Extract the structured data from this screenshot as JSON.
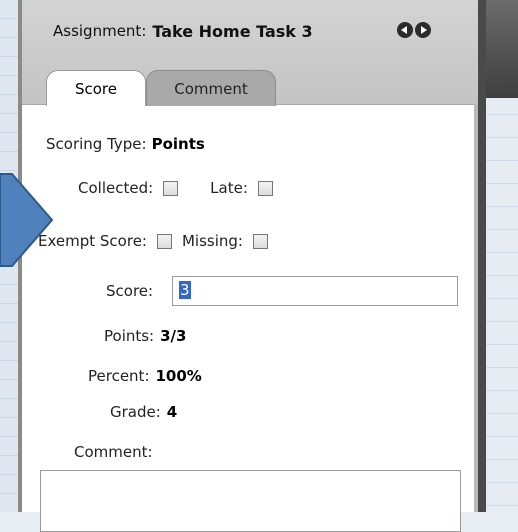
{
  "header": {
    "assignment_label": "Assignment:",
    "assignment_name": "Take Home Task 3",
    "prev_icon": "triangle-left-icon",
    "next_icon": "triangle-right-icon"
  },
  "tabs": [
    {
      "label": "Score",
      "active": true
    },
    {
      "label": "Comment",
      "active": false
    }
  ],
  "form": {
    "scoring_type_label": "Scoring Type:",
    "scoring_type_value": "Points",
    "collected_label": "Collected:",
    "late_label": "Late:",
    "exempt_label": "Exempt Score:",
    "missing_label": "Missing:",
    "score_label": "Score:",
    "score_value": "3",
    "points_label": "Points:",
    "points_value": "3/3",
    "percent_label": "Percent:",
    "percent_value": "100%",
    "grade_label": "Grade:",
    "grade_value": "4",
    "comment_label": "Comment:"
  },
  "colors": {
    "callout_fill": "#4f81bd",
    "selection": "#3169c6",
    "tab_inactive": "#a9a9a9"
  }
}
